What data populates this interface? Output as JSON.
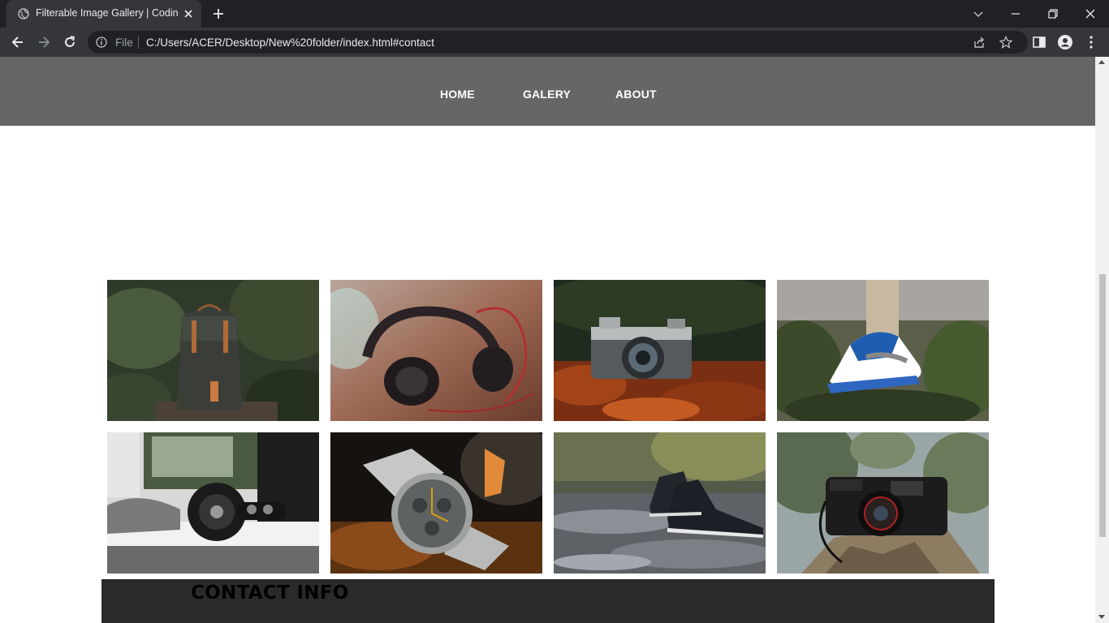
{
  "browser": {
    "tab_title": "Filterable Image Gallery | CodingNepal",
    "scheme_label": "File",
    "url": "C:/Users/ACER/Desktop/New%20folder/index.html#contact"
  },
  "site": {
    "nav": [
      {
        "label": "HOME"
      },
      {
        "label": "GALERY"
      },
      {
        "label": "ABOUT"
      }
    ],
    "gallery": [
      {
        "icon": "backpack-photo"
      },
      {
        "icon": "headphones-photo"
      },
      {
        "icon": "camera-photo"
      },
      {
        "icon": "sneaker-photo"
      },
      {
        "icon": "headphones-desk-photo"
      },
      {
        "icon": "watch-photo"
      },
      {
        "icon": "shoes-water-photo"
      },
      {
        "icon": "yashica-camera-photo"
      }
    ],
    "contact_title": "CONTACT INFO"
  },
  "colors": {
    "nav_bg": "#666666",
    "contact_bg": "#2a2a2a",
    "chrome_dark": "#202124",
    "chrome_tab": "#35363a"
  }
}
